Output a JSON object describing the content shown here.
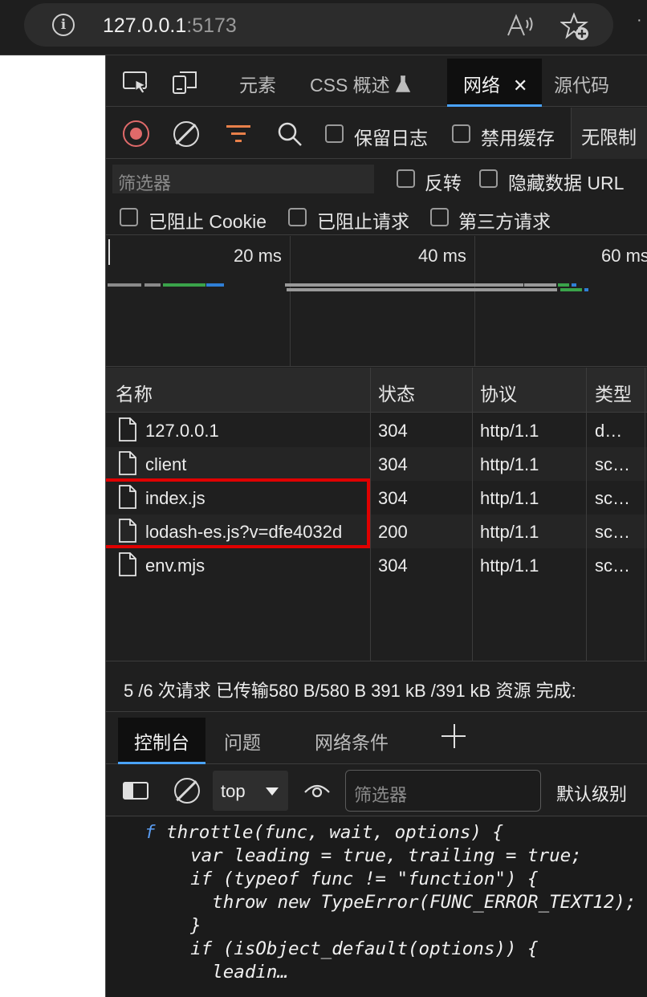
{
  "browser": {
    "url_host": "127.0.0.1",
    "url_port": ":5173"
  },
  "devtools": {
    "tabs": {
      "elements": "元素",
      "css_overview": "CSS 概述",
      "network": "网络",
      "sources": "源代码"
    },
    "toolbar": {
      "preserve_log": "保留日志",
      "disable_cache": "禁用缓存",
      "throttling": "无限制"
    },
    "filter": {
      "placeholder": "筛选器",
      "invert": "反转",
      "hide_data_urls": "隐藏数据 URL",
      "blocked_cookies": "已阻止 Cookie",
      "blocked_requests": "已阻止请求",
      "third_party": "第三方请求"
    },
    "timeline": {
      "ticks": [
        "20 ms",
        "40 ms",
        "60 ms"
      ]
    },
    "table": {
      "headers": {
        "name": "名称",
        "status": "状态",
        "protocol": "协议",
        "type": "类型"
      },
      "rows": [
        {
          "name": "127.0.0.1",
          "status": "304",
          "protocol": "http/1.1",
          "type": "d…"
        },
        {
          "name": "client",
          "status": "304",
          "protocol": "http/1.1",
          "type": "sc…"
        },
        {
          "name": "index.js",
          "status": "304",
          "protocol": "http/1.1",
          "type": "sc…"
        },
        {
          "name": "lodash-es.js?v=dfe4032d",
          "status": "200",
          "protocol": "http/1.1",
          "type": "sc…"
        },
        {
          "name": "env.mjs",
          "status": "304",
          "protocol": "http/1.1",
          "type": "sc…"
        }
      ]
    },
    "summary": "5 /6 次请求  已传输580 B/580 B  391 kB /391 kB 资源  完成:",
    "drawer": {
      "tabs": {
        "console": "控制台",
        "issues": "问题",
        "network_conditions": "网络条件"
      },
      "context": "top",
      "filter_placeholder": "筛选器",
      "level": "默认级别"
    },
    "console_output": {
      "fn_marker": "f",
      "lines": [
        "throttle(func, wait, options) {",
        "  var leading = true, trailing = true;",
        "  if (typeof func != \"function\") {",
        "    throw new TypeError(FUNC_ERROR_TEXT12);",
        "  }",
        "  if (isObject_default(options)) {",
        "    leadin…"
      ]
    }
  },
  "colors": {
    "accent": "#4aa3ff",
    "record": "#e06a6a",
    "filter_icon": "#e8804a",
    "highlight_box": "#e00000"
  }
}
